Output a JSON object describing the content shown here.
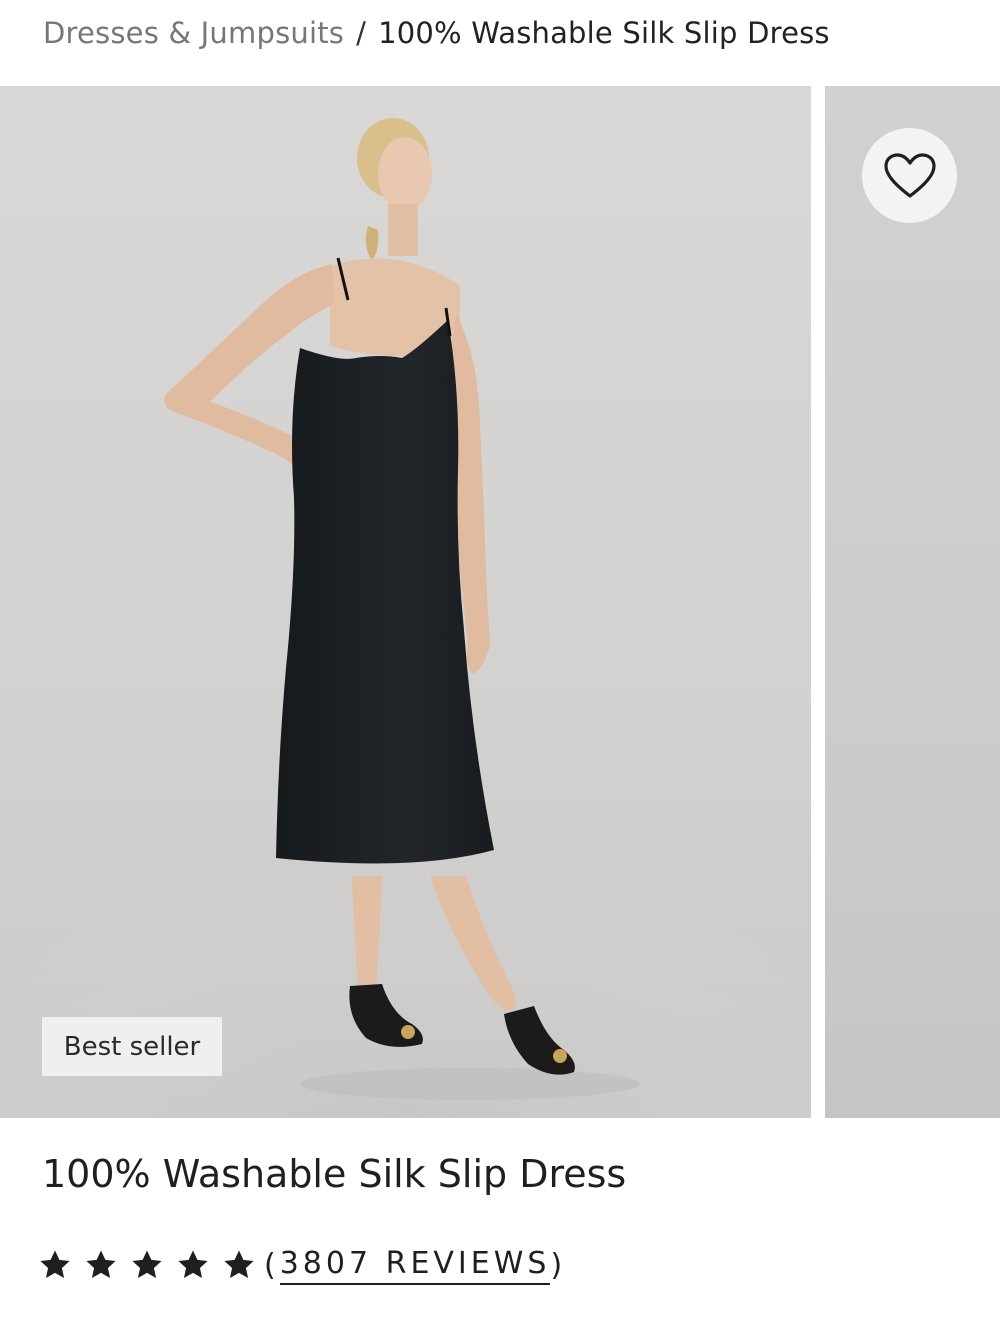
{
  "breadcrumb": {
    "parent": "Dresses & Jumpsuits",
    "separator": "/",
    "current": "100% Washable Silk Slip Dress"
  },
  "gallery": {
    "badge": "Best seller",
    "favorite_icon": "heart-outline-icon",
    "image_alt": "Model wearing black silk slip dress and black sandals"
  },
  "product": {
    "title": "100% Washable Silk Slip Dress",
    "rating": {
      "stars": 5,
      "open_paren": "(",
      "reviews_label": "3807 REVIEWS",
      "close_paren": ")"
    }
  },
  "colors": {
    "text": "#1f1f1f",
    "muted": "#777777",
    "badge_bg": "#efefee",
    "fav_bg": "#f3f3f3"
  }
}
